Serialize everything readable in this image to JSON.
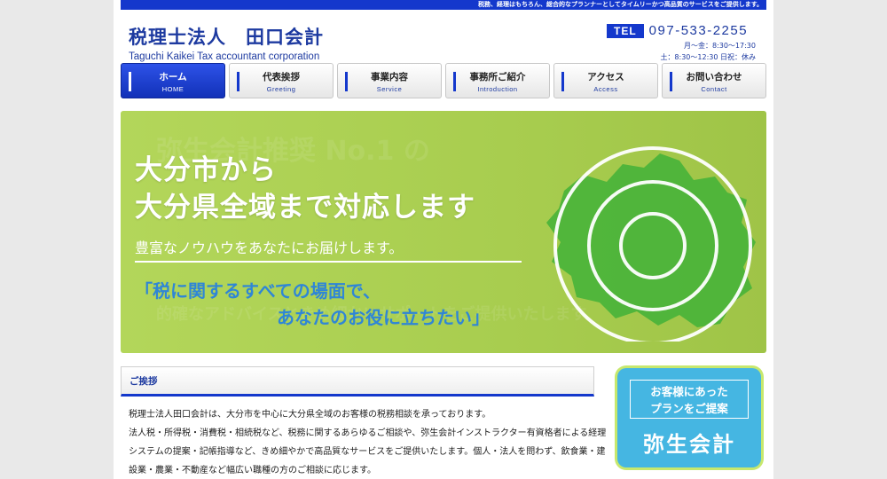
{
  "topbar": {
    "tagline": "税務、経理はもちろん、総合的なプランナーとしてタイムリーかつ高品質のサービスをご提供します。"
  },
  "header": {
    "company_jp": "税理士法人　田口会計",
    "company_en": "Taguchi Kaikei Tax accountant corporation",
    "tel_label": "TEL",
    "tel_number": "097-533-2255",
    "hours_weekday": "月～金：8:30～17:30",
    "hours_saturday": "土：8:30～12:30 日祝：休み"
  },
  "nav": {
    "items": [
      {
        "jp": "ホーム",
        "en": "HOME"
      },
      {
        "jp": "代表挨拶",
        "en": "Greeting"
      },
      {
        "jp": "事業内容",
        "en": "Service"
      },
      {
        "jp": "事務所ご紹介",
        "en": "Introduction"
      },
      {
        "jp": "アクセス",
        "en": "Access"
      },
      {
        "jp": "お問い合わせ",
        "en": "Contact"
      }
    ],
    "active_index": 0
  },
  "hero": {
    "ghost_line1": "弥生会計推奨 No.1 の",
    "ghost_line2": "的確なアドバイスときめ細かいサポートをご提供いたします",
    "headline_1": "大分市から",
    "headline_2": "大分県全域まで対応します",
    "subline": "豊富なノウハウをあなたにお届けします。",
    "quote_1": "「税に関するすべての場面で、",
    "quote_2": "あなたのお役に立ちたい」",
    "accent_color": "#2f86d6",
    "bg_color": "#a8cd4f"
  },
  "greeting": {
    "heading": "ご挨拶",
    "lines": [
      "税理士法人田口会計は、大分市を中心に大分県全域のお客様の税務相談を承っております。",
      "法人税・所得税・消費税・相続税など、税務に関するあらゆるご相談や、弥生会計インストラクター有資格者による経理",
      "システムの提案・記帳指導など、きめ細やかで高品質なサービスをご提供いたします。個人・法人を問わず、飲食業・建",
      "設業・農業・不動産など幅広い職種の方のご相談に応じます。"
    ]
  },
  "banner": {
    "line_1": "お客様にあった",
    "line_2": "プランをご提案",
    "title": "弥生会計",
    "bg_color": "#45b6e2"
  },
  "colors": {
    "brand_blue": "#1438cc"
  }
}
